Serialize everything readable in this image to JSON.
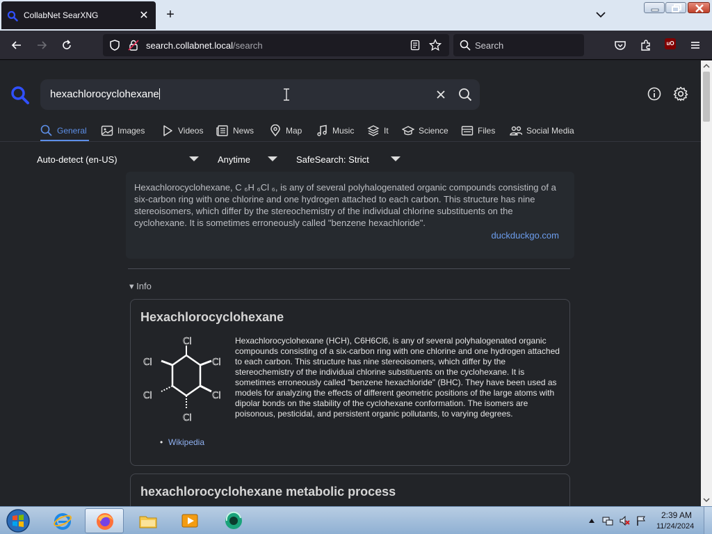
{
  "browser": {
    "tab": {
      "title": "CollabNet SearXNG",
      "close_glyph": "✕"
    },
    "new_tab_glyph": "+",
    "url": {
      "host": "search.collabnet.local",
      "path": "/search"
    },
    "search_placeholder": "Search",
    "ublock_badge": "uO"
  },
  "searx": {
    "query": "hexachlorocyclohexane",
    "categories": [
      {
        "label": "General",
        "icon": "search-icon",
        "active": true
      },
      {
        "label": "Images",
        "icon": "image-icon"
      },
      {
        "label": "Videos",
        "icon": "play-icon"
      },
      {
        "label": "News",
        "icon": "newspaper-icon"
      },
      {
        "label": "Map",
        "icon": "map-pin-icon"
      },
      {
        "label": "Music",
        "icon": "music-icon"
      },
      {
        "label": "It",
        "icon": "layers-icon"
      },
      {
        "label": "Science",
        "icon": "graduation-cap-icon"
      },
      {
        "label": "Files",
        "icon": "folder-icon"
      },
      {
        "label": "Social Media",
        "icon": "people-icon"
      }
    ],
    "filters": {
      "language": "Auto-detect (en-US)",
      "time": "Anytime",
      "safesearch": "SafeSearch: Strict"
    },
    "answer": {
      "text": "Hexachlorocyclohexane, C ₆H ₆Cl ₆, is any of several polyhalogenated organic compounds consisting of a six-carbon ring with one chlorine and one hydrogen attached to each carbon. This structure has nine stereoisomers, which differ by the stereochemistry of the individual chlorine substituents on the cyclohexane. It is sometimes erroneously called \"benzene hexachloride\".",
      "source": "duckduckgo.com"
    },
    "info_toggle": "▾ Info",
    "infobox": {
      "title": "Hexachlorocyclohexane",
      "description": "Hexachlorocyclohexane (HCH), C6H6Cl6, is any of several polyhalogenated organic compounds consisting of a six-carbon ring with one chlorine and one hydrogen attached to each carbon. This structure has nine stereoisomers, which differ by the stereochemistry of the individual chlorine substituents on the cyclohexane. It is sometimes erroneously called \"benzene hexachloride\" (BHC). They have been used as models for analyzing the effects of different geometric positions of the large atoms with dipolar bonds on the stability of the cyclohexane conformation. The isomers are poisonous, pesticidal, and persistent organic pollutants, to varying degrees.",
      "bullet": "•",
      "link": "Wikipedia",
      "atom_label": "Cl"
    },
    "infobox2": {
      "title": "hexachlorocyclohexane metabolic process"
    }
  },
  "taskbar": {
    "time": "2:39 AM",
    "date": "11/24/2024"
  },
  "colors": {
    "accent": "#5d8fe8",
    "link": "#6d9eee",
    "page_bg": "#222428"
  }
}
